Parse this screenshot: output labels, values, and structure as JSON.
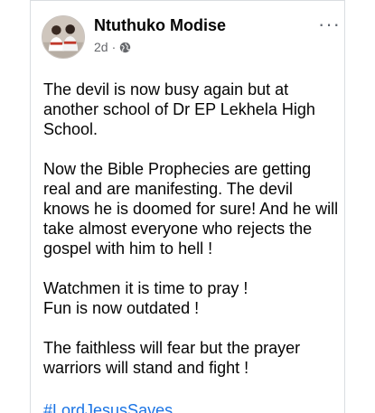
{
  "post": {
    "author": "Ntuthuko Modise",
    "time": "2d",
    "separator": "·",
    "privacy_icon": "globe-icon",
    "more_label": "···",
    "paragraphs": [
      "The devil is now busy again but at another school of Dr EP Lekhela High School.",
      "Now the Bible Prophecies are getting real and are manifesting. The devil knows he is doomed for sure! And he will take almost everyone who rejects the gospel with him to hell !",
      "Watchmen it is time to pray !\nFun is now outdated !",
      "The faithless will fear but the prayer warriors will stand and fight !"
    ],
    "hashtag": "#LordJesusSaves"
  },
  "colors": {
    "text": "#050505",
    "meta": "#65676b",
    "link": "#1b74e4",
    "divider": "#dadde1"
  }
}
